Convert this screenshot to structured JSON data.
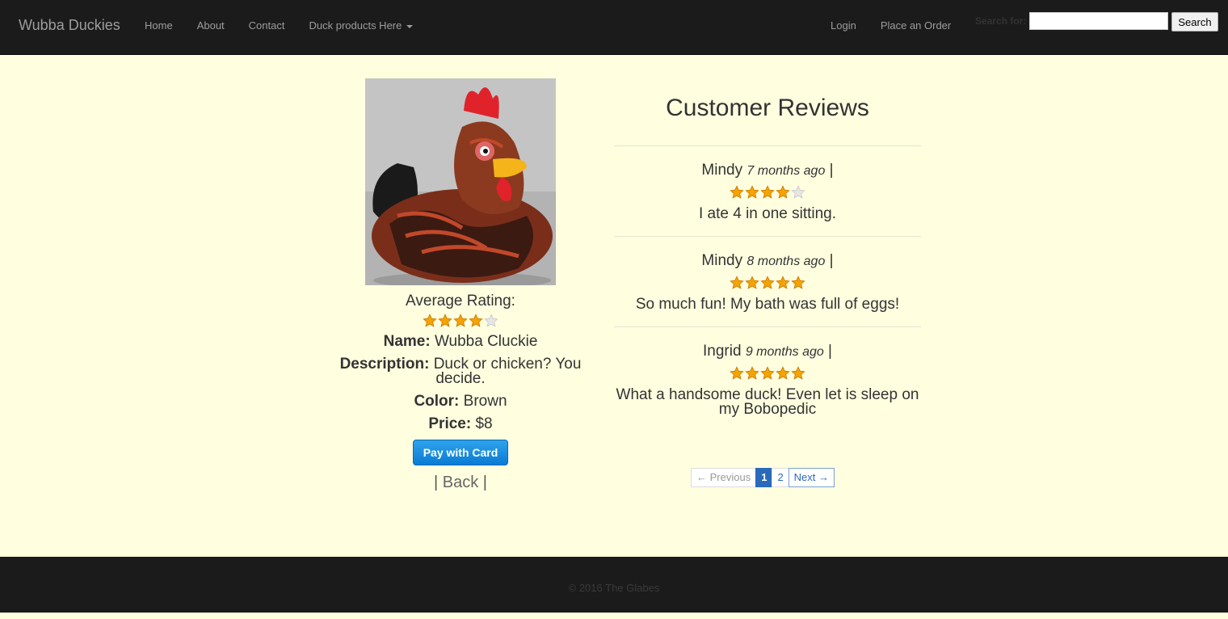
{
  "navbar": {
    "brand": "Wubba Duckies",
    "links": [
      "Home",
      "About",
      "Contact"
    ],
    "dropdown_label": "Duck products Here",
    "right_links": [
      "Login",
      "Place an Order"
    ],
    "search_label": "Search for:",
    "search_value": "",
    "search_button": "Search"
  },
  "product": {
    "image_alt": "Wubba Cluckie",
    "average_rating_label": "Average Rating:",
    "average_rating": 4,
    "max_rating": 5,
    "name_label": "Name:",
    "name": "Wubba Cluckie",
    "description_label": "Description:",
    "description": "Duck or chicken? You decide.",
    "color_label": "Color:",
    "color": "Brown",
    "price_label": "Price:",
    "price": "$8",
    "pay_button": "Pay with Card",
    "back_left_sep": "|",
    "back_label": "Back",
    "back_right_sep": "|"
  },
  "reviews": {
    "title": "Customer Reviews",
    "items": [
      {
        "author": "Mindy",
        "time": "7 months ago",
        "sep": "|",
        "rating": 4,
        "text": "I ate 4 in one sitting."
      },
      {
        "author": "Mindy",
        "time": "8 months ago",
        "sep": "|",
        "rating": 5,
        "text": "So much fun! My bath was full of eggs!"
      },
      {
        "author": "Ingrid",
        "time": "9 months ago",
        "sep": "|",
        "rating": 5,
        "text": "What a handsome duck! Even let is sleep on my Bobopedic"
      }
    ]
  },
  "pagination": {
    "previous": "← Previous",
    "pages": [
      "1",
      "2"
    ],
    "active_page": "1",
    "next": "Next →"
  },
  "footer": {
    "text": "© 2016 The Glabes"
  },
  "colors": {
    "navbar_bg": "#1b1b1b",
    "page_bg": "#ffffe0",
    "star_filled": "#f5a300",
    "star_empty": "#e6e6e6",
    "pay_button": "#0a7bd3"
  }
}
